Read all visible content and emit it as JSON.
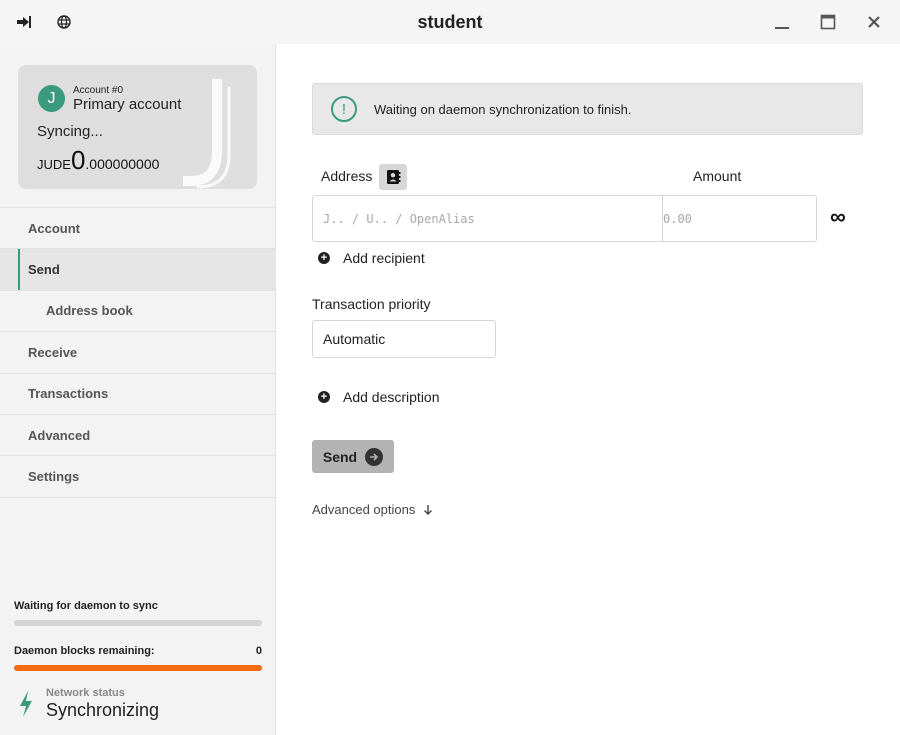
{
  "window": {
    "title": "student"
  },
  "titlebar": {
    "left_icons": [
      "logout-icon",
      "globe-icon"
    ],
    "right_icons": [
      "minimize-icon",
      "maximize-icon",
      "close-icon"
    ]
  },
  "account_card": {
    "avatar_letter": "J",
    "account_number": "Account #0",
    "account_name": "Primary account",
    "status": "Syncing...",
    "currency": "JUDE",
    "balance_integer": "0",
    "balance_decimal": ".000000000"
  },
  "sidebar": {
    "items": [
      {
        "label": "Account"
      },
      {
        "label": "Send"
      },
      {
        "label": "Address book"
      },
      {
        "label": "Receive"
      },
      {
        "label": "Transactions"
      },
      {
        "label": "Advanced"
      },
      {
        "label": "Settings"
      }
    ],
    "active": "Send",
    "sync": {
      "waiting_label": "Waiting for daemon to sync",
      "waiting_progress": 0,
      "blocks_label": "Daemon blocks remaining:",
      "blocks_value": "0",
      "blocks_progress": 1.0
    },
    "network": {
      "label": "Network status",
      "value": "Synchronizing"
    }
  },
  "main": {
    "banner_text": "Waiting on daemon synchronization to finish.",
    "address_label": "Address",
    "amount_label": "Amount",
    "address_placeholder": "J.. / U.. / OpenAlias",
    "amount_placeholder": "0.00",
    "max_symbol": "∞",
    "add_recipient": "Add recipient",
    "priority_label": "Transaction priority",
    "priority_value": "Automatic",
    "add_description": "Add description",
    "send_label": "Send",
    "advanced_options": "Advanced options"
  },
  "colors": {
    "accent": "#3b9a7e",
    "progress_orange": "#f26a12",
    "sidebar_bg": "#f3f3f3"
  }
}
